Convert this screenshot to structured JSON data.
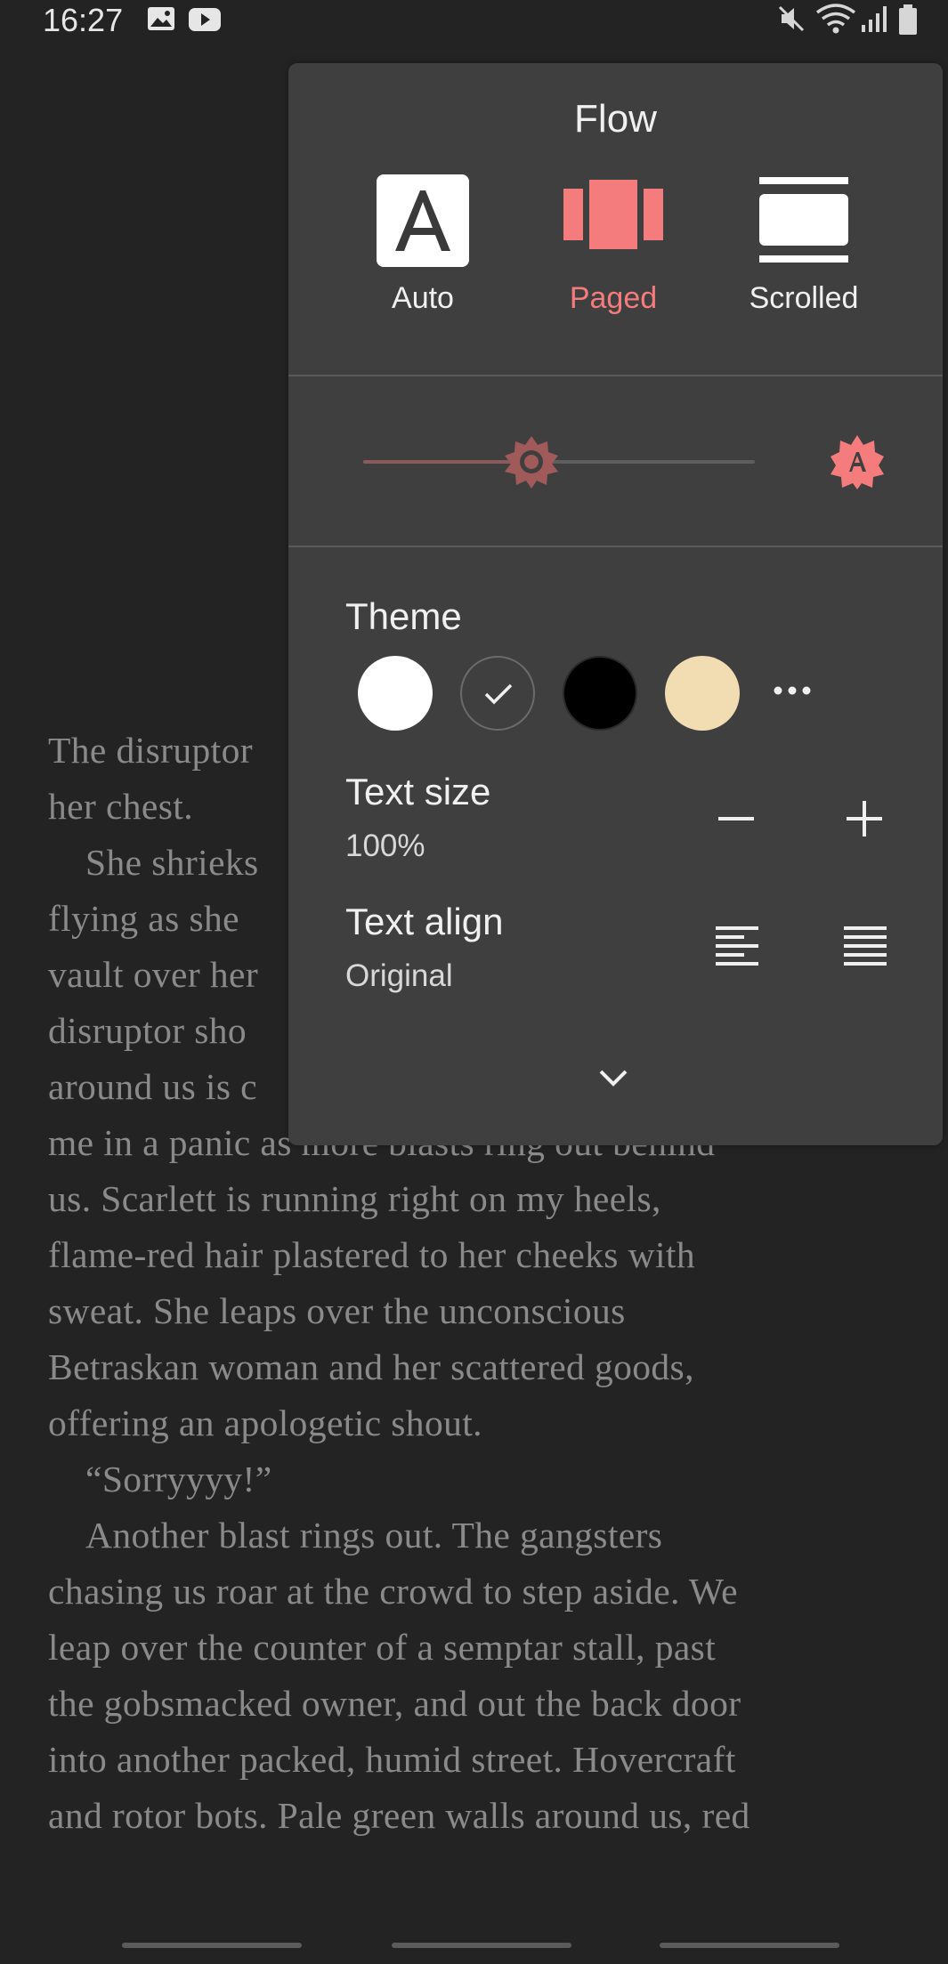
{
  "status_bar": {
    "time": "16:27",
    "left_icons": [
      "image-icon",
      "youtube-icon"
    ],
    "right_icons": [
      "mute-icon",
      "wifi-icon",
      "signal-icon",
      "battery-icon"
    ]
  },
  "reader": {
    "lines": [
      {
        "text": "The disruptor",
        "indent": false
      },
      {
        "text": "her chest.",
        "indent": false
      },
      {
        "text": "She shrieks",
        "indent": true
      },
      {
        "text": "flying as she",
        "indent": false
      },
      {
        "text": "vault over her",
        "indent": false
      },
      {
        "text": "disruptor sho",
        "indent": false
      },
      {
        "text": "around us is c",
        "indent": false
      },
      {
        "text": "me in a panic as more blasts ring out behind",
        "indent": false
      },
      {
        "text": "us. Scarlett is running right on my heels,",
        "indent": false
      },
      {
        "text": "flame-red hair plastered to her cheeks with",
        "indent": false
      },
      {
        "text": "sweat. She leaps over the unconscious",
        "indent": false
      },
      {
        "text": "Betraskan woman and her scattered goods,",
        "indent": false
      },
      {
        "text": "offering an apologetic shout.",
        "indent": false
      },
      {
        "text": "“Sorryyyy!”",
        "indent": true
      },
      {
        "text": "Another blast rings out. The gangsters",
        "indent": true
      },
      {
        "text": "chasing us roar at the crowd to step aside. We",
        "indent": false
      },
      {
        "text": "leap over the counter of a semptar stall, past",
        "indent": false
      },
      {
        "text": "the gobsmacked owner, and out the back door",
        "indent": false
      },
      {
        "text": "into another packed, humid street. Hovercraft",
        "indent": false
      },
      {
        "text": "and rotor bots. Pale green walls around us, red",
        "indent": false
      }
    ]
  },
  "panel": {
    "flow": {
      "title": "Flow",
      "options": [
        {
          "label": "Auto",
          "icon": "auto-flow-icon",
          "selected": false
        },
        {
          "label": "Paged",
          "icon": "paged-flow-icon",
          "selected": true
        },
        {
          "label": "Scrolled",
          "icon": "scrolled-flow-icon",
          "selected": false
        }
      ]
    },
    "brightness": {
      "level": 0.43,
      "icon": "brightness-icon",
      "auto_icon": "auto-brightness-icon"
    },
    "theme": {
      "label": "Theme",
      "swatches": [
        {
          "name": "white",
          "color": "#ffffff",
          "selected": false
        },
        {
          "name": "dark-gray",
          "color": "#3f3f3f",
          "selected": true
        },
        {
          "name": "black",
          "color": "#000000",
          "selected": false
        },
        {
          "name": "sepia",
          "color": "#f2ddb3",
          "selected": false
        }
      ],
      "more_icon": "more-horizontal-icon"
    },
    "text_size": {
      "label": "Text size",
      "value": "100%",
      "decrease_icon": "minus-icon",
      "increase_icon": "plus-icon"
    },
    "text_align": {
      "label": "Text align",
      "value": "Original",
      "options": [
        "align-left-icon",
        "align-justify-icon"
      ]
    },
    "collapse_icon": "chevron-down-icon"
  },
  "colors": {
    "accent": "#f47c7c",
    "panel_bg": "#3f3f3f",
    "page_bg": "#232323",
    "reader_text": "#8a8a8a"
  }
}
